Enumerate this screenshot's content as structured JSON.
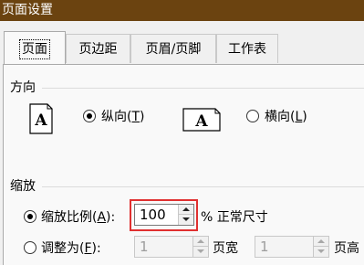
{
  "window": {
    "title": "页面设置"
  },
  "tabs": [
    {
      "label": "页面",
      "active": true
    },
    {
      "label": "页边距",
      "active": false
    },
    {
      "label": "页眉/页脚",
      "active": false
    },
    {
      "label": "工作表",
      "active": false
    }
  ],
  "orientation": {
    "title": "方向",
    "portrait": {
      "label": "纵向(T)",
      "label_pre": "纵向(",
      "key": "T",
      "label_post": ")",
      "selected": true,
      "icon": "page-portrait-icon"
    },
    "landscape": {
      "label": "横向(L)",
      "label_pre": "横向(",
      "key": "L",
      "label_post": ")",
      "selected": false,
      "icon": "page-landscape-icon"
    },
    "icon_glyph": "A"
  },
  "scaling": {
    "title": "缩放",
    "adjust": {
      "label": "缩放比例(A):",
      "label_pre": "缩放比例(",
      "key": "A",
      "label_post": "):",
      "selected": true,
      "value": "100",
      "suffix": "% 正常尺寸"
    },
    "fit": {
      "label": "调整为(F):",
      "label_pre": "调整为(",
      "key": "F",
      "label_post": "):",
      "selected": false,
      "wide_value": "1",
      "wide_label": "页宽",
      "tall_value": "1",
      "tall_label": "页高"
    }
  },
  "colors": {
    "titlebar": "#6b4310",
    "highlight": "#e03030"
  }
}
